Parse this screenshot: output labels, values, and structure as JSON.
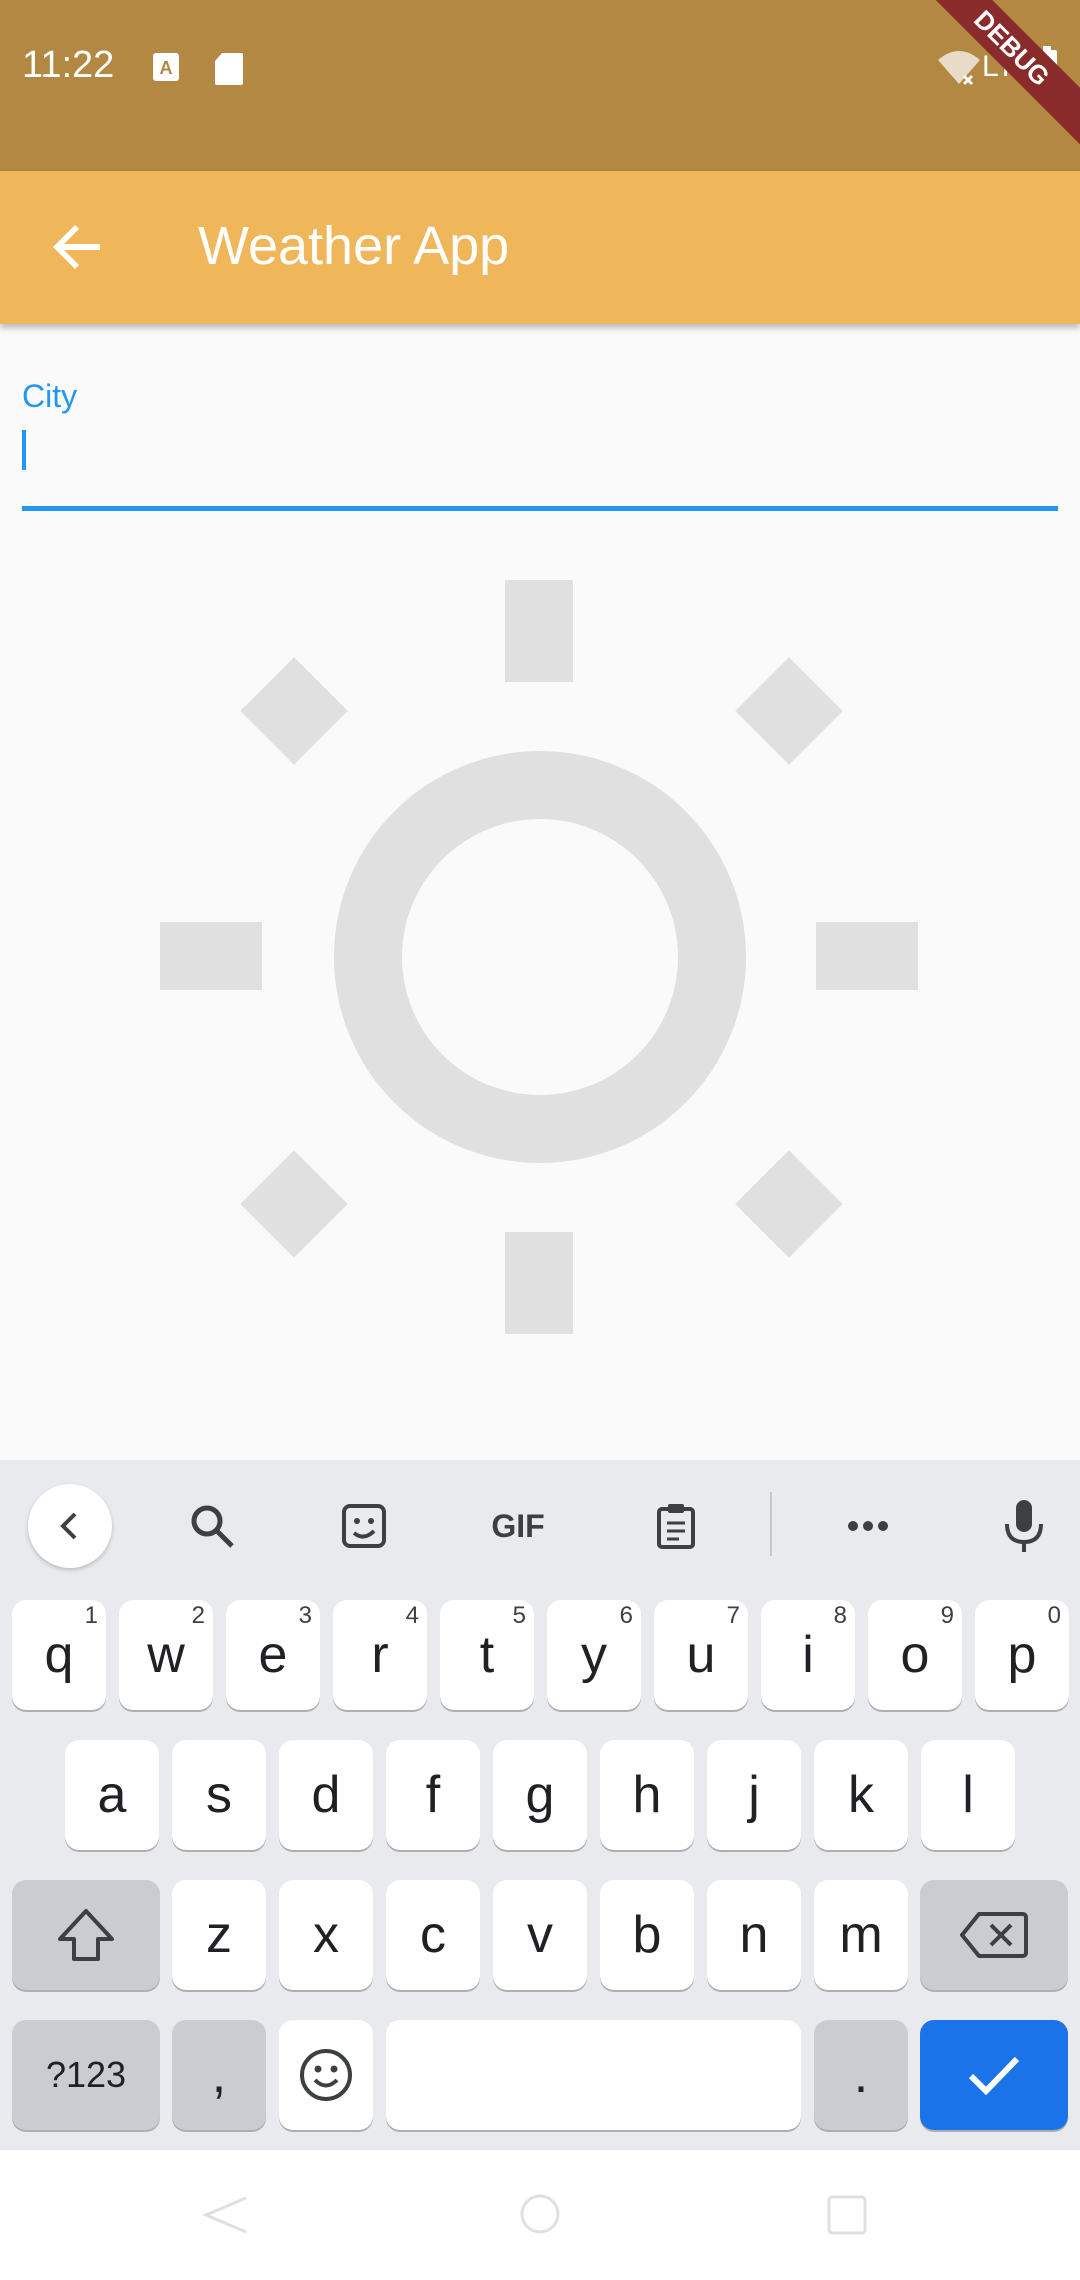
{
  "status_bar": {
    "time": "11:22",
    "icons": [
      "a-icon",
      "sd-card-icon",
      "wifi-off-icon",
      "lte-icon",
      "battery-icon"
    ],
    "lte_label": "LTE",
    "debug_banner": "DEBUG"
  },
  "app_bar": {
    "title": "Weather App",
    "background_color": "#f0b65a"
  },
  "city_field": {
    "label": "City",
    "value": "",
    "accent_color": "#2196f3"
  },
  "weather_icon": "sun-icon",
  "keyboard": {
    "toolbar": [
      "chevron-left-icon",
      "search-icon",
      "sticker-icon",
      "gif",
      "clipboard-icon",
      "more-icon",
      "mic-icon"
    ],
    "gif_label": "GIF",
    "rows": [
      [
        {
          "key": "q",
          "hint": "1"
        },
        {
          "key": "w",
          "hint": "2"
        },
        {
          "key": "e",
          "hint": "3"
        },
        {
          "key": "r",
          "hint": "4"
        },
        {
          "key": "t",
          "hint": "5"
        },
        {
          "key": "y",
          "hint": "6"
        },
        {
          "key": "u",
          "hint": "7"
        },
        {
          "key": "i",
          "hint": "8"
        },
        {
          "key": "o",
          "hint": "9"
        },
        {
          "key": "p",
          "hint": "0"
        }
      ],
      [
        {
          "key": "a"
        },
        {
          "key": "s"
        },
        {
          "key": "d"
        },
        {
          "key": "f"
        },
        {
          "key": "g"
        },
        {
          "key": "h"
        },
        {
          "key": "j"
        },
        {
          "key": "k"
        },
        {
          "key": "l"
        }
      ],
      [
        {
          "key": "z"
        },
        {
          "key": "x"
        },
        {
          "key": "c"
        },
        {
          "key": "v"
        },
        {
          "key": "b"
        },
        {
          "key": "n"
        },
        {
          "key": "m"
        }
      ]
    ],
    "symbols_label": "?123",
    "comma_label": ",",
    "period_label": ".",
    "enter_color": "#1a73e8"
  },
  "nav_bar": [
    "back-icon",
    "home-icon",
    "recents-icon"
  ]
}
